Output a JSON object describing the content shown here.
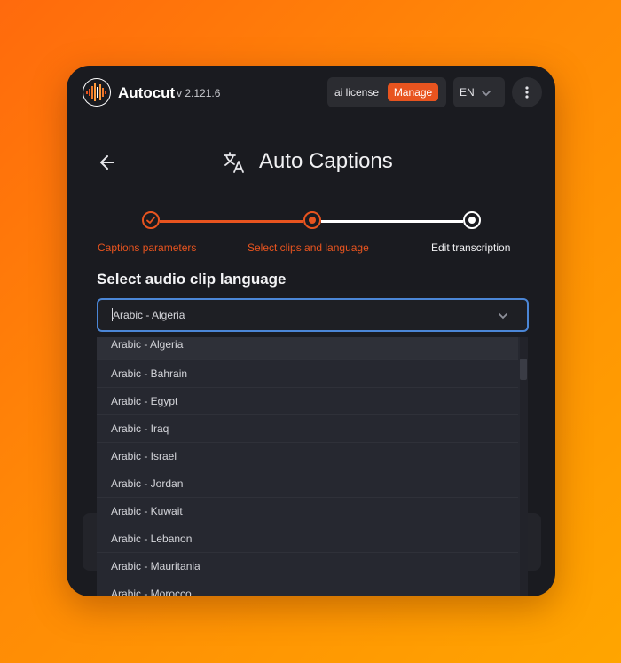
{
  "header": {
    "app_name": "Autocut",
    "version": "v 2.121.6",
    "license_label": "ai license",
    "manage_label": "Manage",
    "language": "EN"
  },
  "page": {
    "title": "Auto Captions"
  },
  "stepper": {
    "steps": [
      {
        "label": "Captions parameters",
        "state": "completed"
      },
      {
        "label": "Select clips and language",
        "state": "current"
      },
      {
        "label": "Edit transcription",
        "state": "upcoming"
      }
    ]
  },
  "language_select": {
    "heading": "Select audio clip language",
    "value": "Arabic - Algeria",
    "options": [
      "Arabic - Algeria",
      "Arabic - Bahrain",
      "Arabic - Egypt",
      "Arabic - Iraq",
      "Arabic - Israel",
      "Arabic - Jordan",
      "Arabic - Kuwait",
      "Arabic - Lebanon",
      "Arabic - Mauritania",
      "Arabic - Morocco"
    ]
  },
  "colors": {
    "accent": "#e8541f",
    "focus": "#4b86d6",
    "background_gradient": [
      "#ff6a0d",
      "#ffa500"
    ],
    "window": "#1a1b20"
  },
  "icons": {
    "logo": "autocut-waveform-logo",
    "back": "arrow-left-icon",
    "title": "translate-icon",
    "chevron": "chevron-down-icon",
    "menu": "more-vertical-icon",
    "check": "check-icon"
  }
}
